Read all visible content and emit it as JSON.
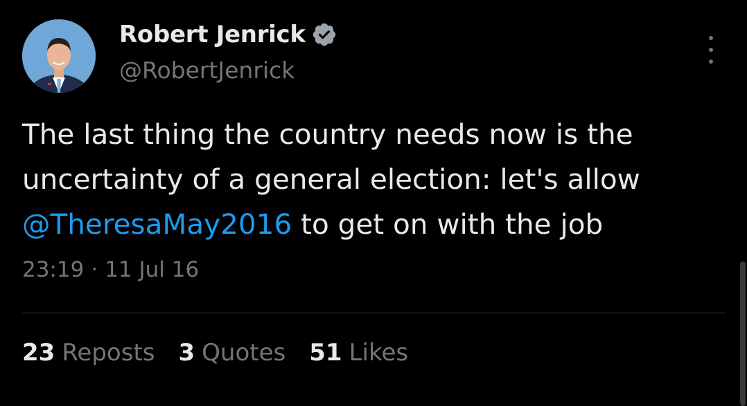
{
  "author": {
    "display_name": "Robert Jenrick",
    "handle": "@RobertJenrick",
    "verified": true
  },
  "tweet": {
    "text_part1": "The last thing the country needs now is the uncertainty of a general election: let's allow ",
    "mention": "@TheresaMay2016",
    "text_part2": " to get on with the job"
  },
  "meta": {
    "time": "23:19",
    "separator": "·",
    "date": "11 Jul 16"
  },
  "stats": [
    {
      "count": "23",
      "label": "Reposts"
    },
    {
      "count": "3",
      "label": "Quotes"
    },
    {
      "count": "51",
      "label": "Likes"
    }
  ],
  "icons": {
    "verified": "verified-badge-icon",
    "more": "more-options-icon"
  },
  "colors": {
    "background": "#000000",
    "text": "#e7e9ea",
    "secondary": "#71767b",
    "link": "#1d9bf0"
  }
}
